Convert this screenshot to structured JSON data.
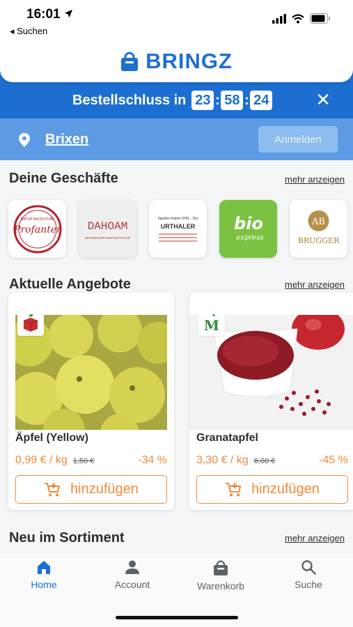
{
  "status_bar": {
    "time": "16:01",
    "back_label": "◂ Suchen"
  },
  "header": {
    "brand": "BRINGZ"
  },
  "countdown": {
    "label": "Bestellschluss in",
    "hours": "23",
    "minutes": "58",
    "seconds": "24",
    "close": "✕"
  },
  "location": {
    "city": "Brixen",
    "login_label": "Anmelden"
  },
  "shops": {
    "title": "Deine Geschäfte",
    "more": "mehr anzeigen",
    "items": [
      {
        "name": "Profanter",
        "sub": "NATUR BACKSTUBE"
      },
      {
        "name": "DAHOAM",
        "sub": "BRIXNER BRAUMANUFAKTUR"
      },
      {
        "name": "URTHALER",
        "sub": "Tapeten Import OHG - Snc"
      },
      {
        "name": "bio",
        "sub": "express"
      },
      {
        "name": "BRUGGER",
        "sub": "AB"
      }
    ]
  },
  "offers": {
    "title": "Aktuelle Angebote",
    "more": "mehr anzeigen",
    "items": [
      {
        "name": "Äpfel (Yellow)",
        "price": "0,99 € / kg",
        "old_price": "1,50 €",
        "discount": "-34 %",
        "button": "hinzufügen"
      },
      {
        "name": "Granatapfel",
        "price": "3,30 € / kg",
        "old_price": "6,00 €",
        "discount": "-45 %",
        "button": "hinzufügen"
      }
    ]
  },
  "new_section": {
    "title": "Neu im Sortiment",
    "more": "mehr anzeigen"
  },
  "nav": {
    "items": [
      {
        "label": "Home",
        "icon": "home-icon",
        "active": true
      },
      {
        "label": "Account",
        "icon": "person-icon",
        "active": false
      },
      {
        "label": "Warenkorb",
        "icon": "bag-icon",
        "active": false
      },
      {
        "label": "Suche",
        "icon": "search-icon",
        "active": false
      }
    ]
  },
  "colors": {
    "primary": "#1c6fd1",
    "location_bar": "#5d9be4",
    "accent": "#ee8a3a"
  }
}
